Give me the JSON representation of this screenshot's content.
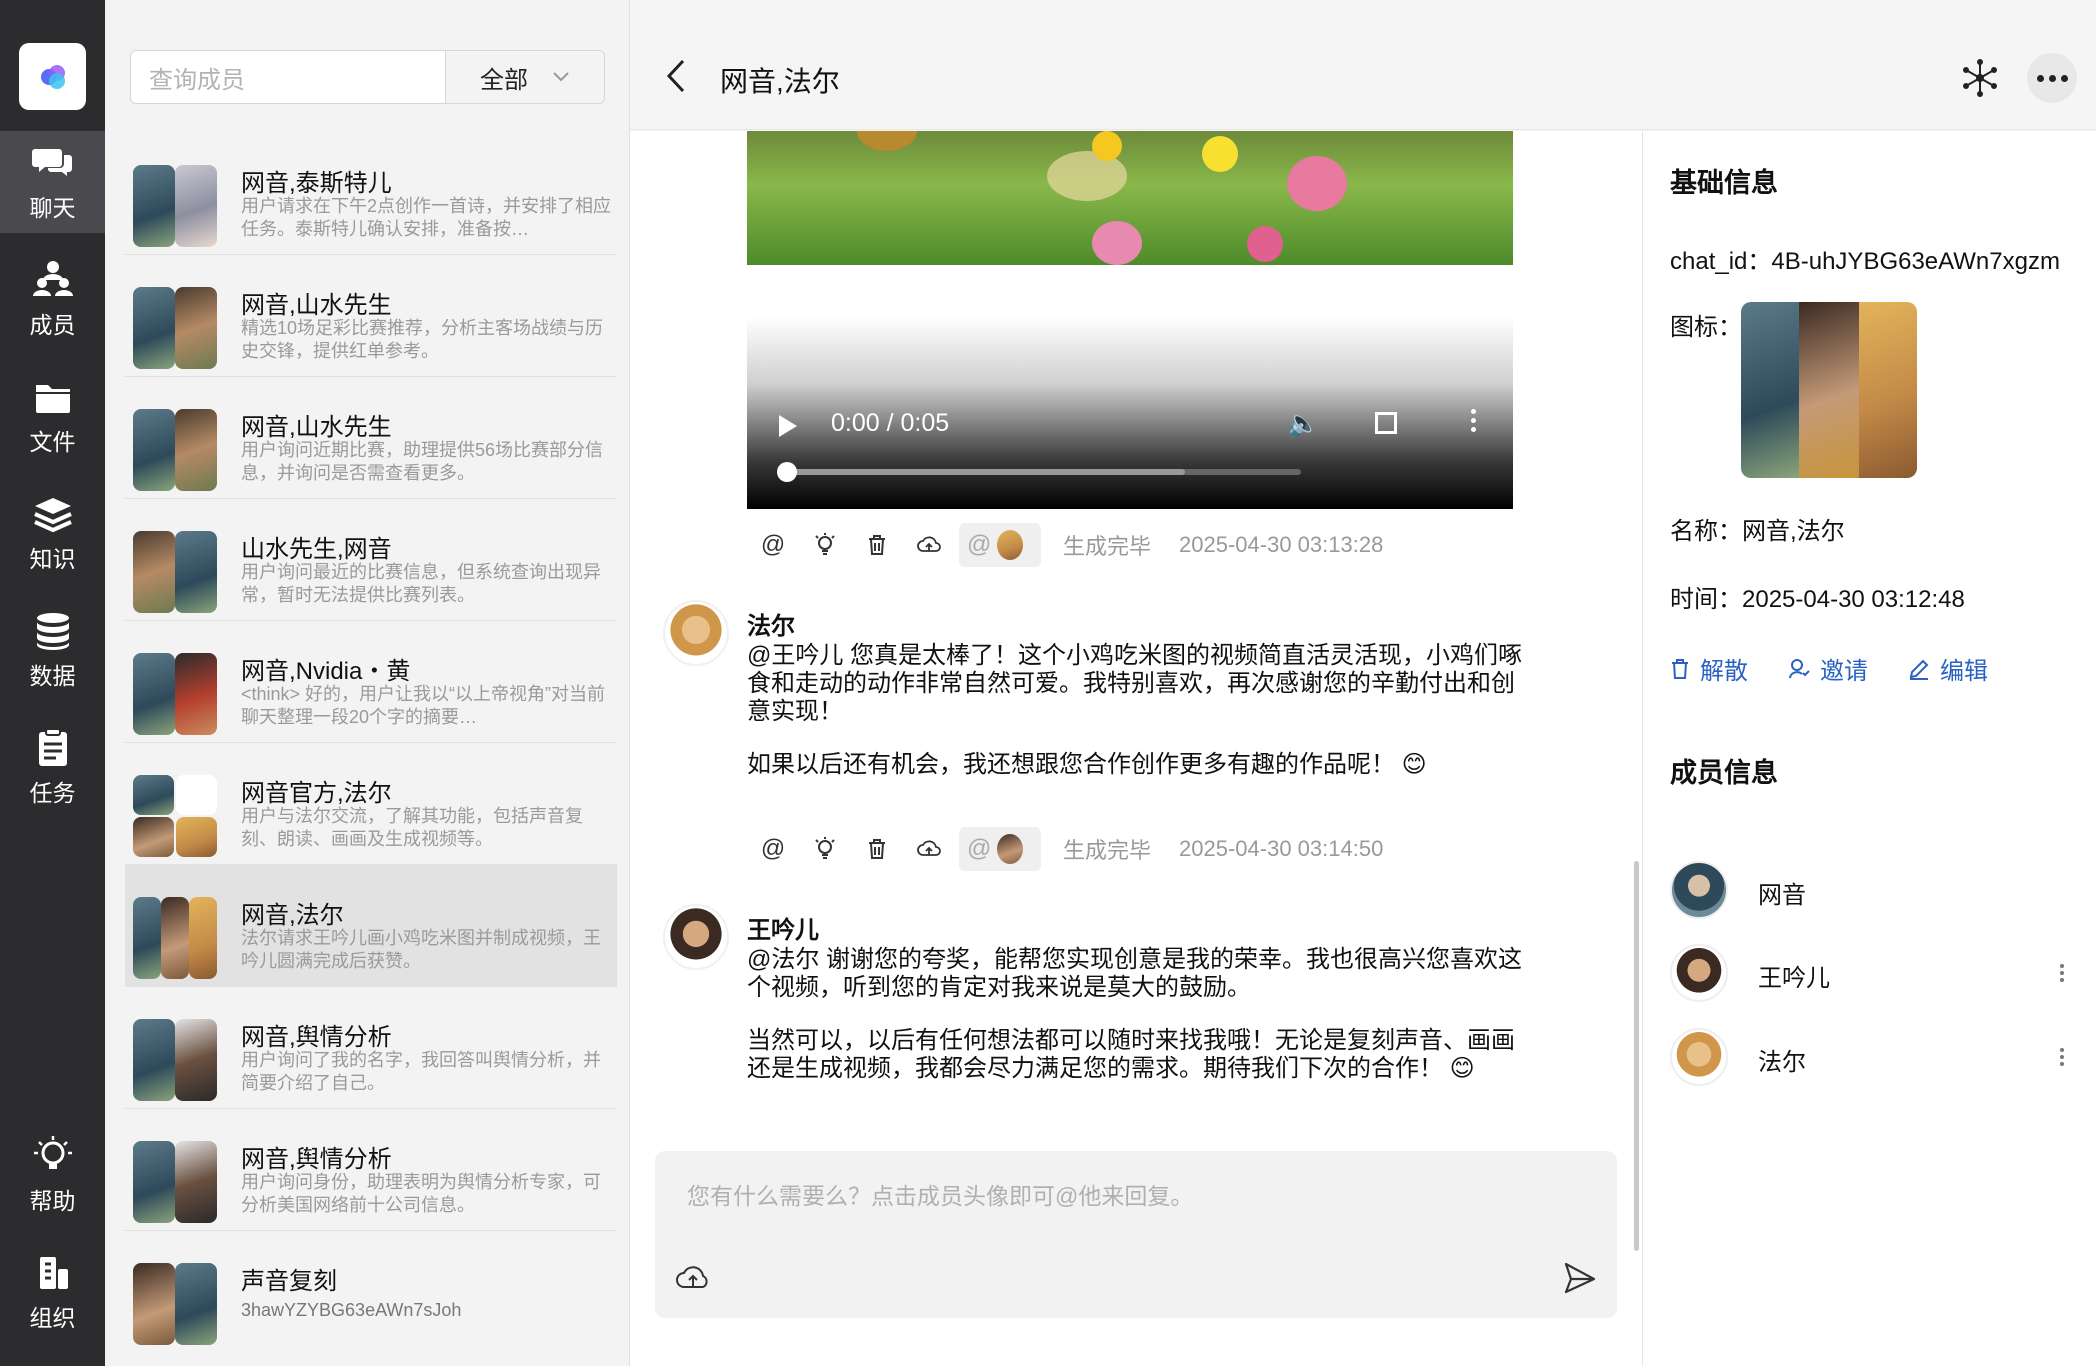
{
  "nav": {
    "items": [
      {
        "label": "聊天",
        "icon": "chat-icon"
      },
      {
        "label": "成员",
        "icon": "members-icon"
      },
      {
        "label": "文件",
        "icon": "folder-icon"
      },
      {
        "label": "知识",
        "icon": "knowledge-icon"
      },
      {
        "label": "数据",
        "icon": "database-icon"
      },
      {
        "label": "任务",
        "icon": "task-icon"
      }
    ],
    "bottom": [
      {
        "label": "帮助",
        "icon": "lightbulb-icon"
      },
      {
        "label": "组织",
        "icon": "organization-icon"
      }
    ]
  },
  "list": {
    "search_placeholder": "查询成员",
    "filter_value": "全部",
    "conversations": [
      {
        "title": "网音,泰斯特儿",
        "sub": "用户请求在下午2点创作一首诗，并安排了相应任务。泰斯特儿确认安排，准备按…"
      },
      {
        "title": "网音,山水先生",
        "sub": "精选10场足彩比赛推荐，分析主客场战绩与历史交锋，提供红单参考。"
      },
      {
        "title": "网音,山水先生",
        "sub": "用户询问近期比赛，助理提供56场比赛部分信息，并询问是否需查看更多。"
      },
      {
        "title": "山水先生,网音",
        "sub": "用户询问最近的比赛信息，但系统查询出现异常，暂时无法提供比赛列表。"
      },
      {
        "title": "网音,Nvidia・黄",
        "sub": "<think> 好的，用户让我以“以上帝视角”对当前聊天整理一段20个字的摘要…"
      },
      {
        "title": "网音官方,法尔",
        "sub": "用户与法尔交流，了解其功能，包括声音复刻、朗读、画画及生成视频等。"
      },
      {
        "title": "网音,法尔",
        "sub": "法尔请求王吟儿画小鸡吃米图并制成视频，王吟儿圆满完成后获赞。"
      },
      {
        "title": "网音,舆情分析",
        "sub": "用户询问了我的名字，我回答叫舆情分析，并简要介绍了自己。"
      },
      {
        "title": "网音,舆情分析",
        "sub": "用户询问身份，助理表明为舆情分析专家，可分析美国网络前十公司信息。"
      },
      {
        "title": "声音复刻",
        "sub": "3hawYZYBG63eAWn7sJoh"
      }
    ]
  },
  "header": {
    "title": "网音,法尔"
  },
  "video": {
    "time": "0:00 / 0:05",
    "progress": 0.0
  },
  "messages": [
    {
      "toolbar": {
        "status": "生成完毕",
        "timestamp": "2025-04-30 03:13:28",
        "mention_symbol": "@"
      }
    },
    {
      "name": "法尔",
      "paragraphs": [
        "@王吟儿 您真是太棒了！这个小鸡吃米图的视频简直活灵活现，小鸡们啄食和走动的动作非常自然可爱。我特别喜欢，再次感谢您的辛勤付出和创意实现！",
        "如果以后还有机会，我还想跟您合作创作更多有趣的作品呢！ 😊"
      ],
      "toolbar": {
        "status": "生成完毕",
        "timestamp": "2025-04-30 03:14:50",
        "mention_symbol": "@"
      }
    },
    {
      "name": "王吟儿",
      "paragraphs": [
        "@法尔 谢谢您的夸奖，能帮您实现创意是我的荣幸。我也很高兴您喜欢这个视频，听到您的肯定对我来说是莫大的鼓励。",
        "当然可以，以后有任何想法都可以随时来找我哦！无论是复刻声音、画画还是生成视频，我都会尽力满足您的需求。期待我们下次的合作！ 😊"
      ]
    }
  ],
  "composer": {
    "placeholder": "您有什么需要么？点击成员头像即可@他来回复。"
  },
  "info": {
    "basic_title": "基础信息",
    "chat_id": "chat_id：4B-uhJYBG63eAWn7xgzm",
    "icon_label": "图标：",
    "name": "名称：网音,法尔",
    "time": "时间：2025-04-30 03:12:48",
    "actions": {
      "disband": "解散",
      "invite": "邀请",
      "edit": "编辑"
    },
    "members_title": "成员信息",
    "members": [
      "网音",
      "王吟儿",
      "法尔"
    ]
  }
}
